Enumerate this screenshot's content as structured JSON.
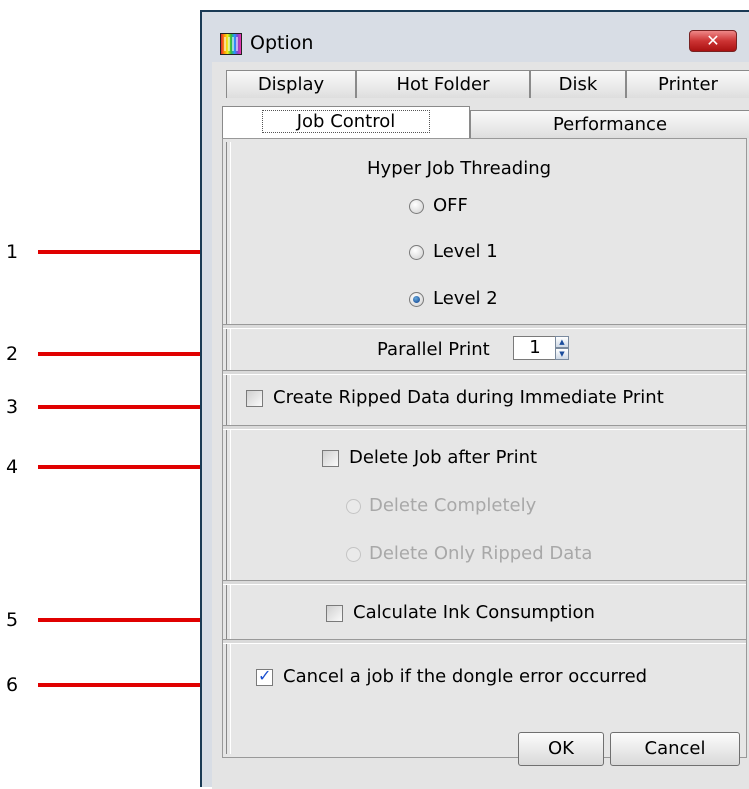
{
  "callouts": [
    "1",
    "2",
    "3",
    "4",
    "5",
    "6"
  ],
  "window": {
    "title": "Option",
    "close_glyph": "✕"
  },
  "tabs": {
    "row1": [
      "Display",
      "Hot Folder",
      "Disk",
      "Printer"
    ],
    "row2": [
      "Job Control",
      "Performance"
    ]
  },
  "job_control": {
    "hyper_threading": {
      "heading": "Hyper Job Threading",
      "options": [
        "OFF",
        "Level 1",
        "Level 2"
      ],
      "selected": "Level 2"
    },
    "parallel_print": {
      "label": "Parallel Print",
      "value": "1"
    },
    "create_ripped": {
      "label": "Create Ripped Data during Immediate Print",
      "checked": false
    },
    "delete_job": {
      "label": "Delete Job after Print",
      "checked": false,
      "options": [
        "Delete Completely",
        "Delete Only Ripped Data"
      ]
    },
    "calculate_ink": {
      "label": "Calculate Ink Consumption",
      "checked": false
    },
    "cancel_dongle": {
      "label": "Cancel a job if the dongle error occurred",
      "checked": true,
      "check_glyph": "✓"
    }
  },
  "buttons": {
    "ok": "OK",
    "cancel": "Cancel"
  },
  "icons": {
    "spin_up": "▲",
    "spin_down": "▼"
  },
  "colors": {
    "callout_line": "#e00000",
    "check_mark": "#1b4fd0"
  }
}
